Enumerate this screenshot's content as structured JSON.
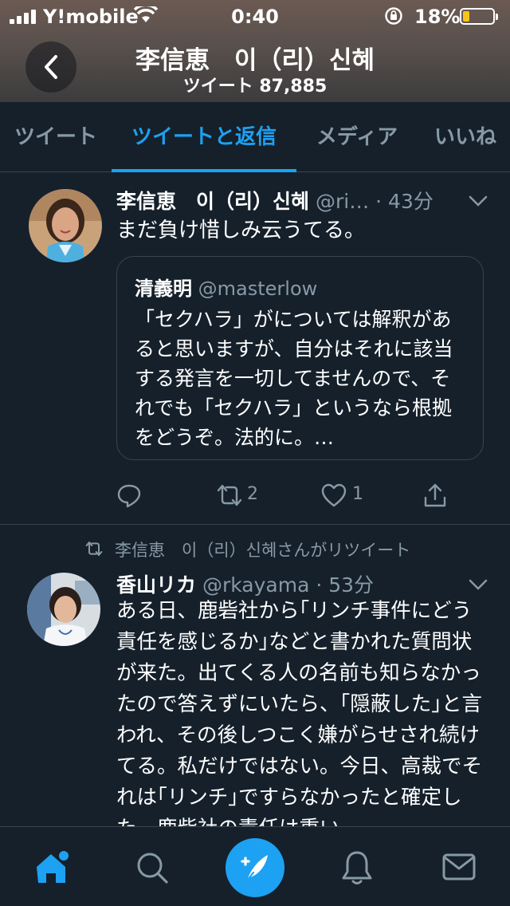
{
  "status_bar": {
    "carrier": "Y!mobile",
    "time": "0:40",
    "battery": "18%",
    "battery_level": 0.18
  },
  "header": {
    "name": "李信恵　이（리）신혜",
    "tweet_count": "ツイート 87,885"
  },
  "tabs": [
    {
      "label": "ツイート",
      "active": false
    },
    {
      "label": "ツイートと返信",
      "active": true
    },
    {
      "label": "メディア",
      "active": false
    },
    {
      "label": "いいね",
      "active": false
    }
  ],
  "tweets": [
    {
      "name": "李信恵　이（리）신혜",
      "handle": "@ri…",
      "time": "· 43分",
      "text": "まだ負け惜しみ云うてる。",
      "quote": {
        "name": "清義明",
        "handle": "@masterlow",
        "text": "「セクハラ」がについては解釈があると思いますが、自分はそれに該当する発言を一切してませんので、それでも「セクハラ」というなら根拠をどうぞ。法的に。…"
      },
      "retweets": "2",
      "likes": "1"
    },
    {
      "retweeted_by": "李信恵　이（리）신혜さんがリツイート",
      "name": "香山リカ",
      "handle": "@rkayama",
      "time": "· 53分",
      "text": "ある日、鹿砦社から｢リンチ事件にどう責任を感じるか｣などと書かれた質問状が来た。出てくる人の名前も知らなかったので答えずにいたら、｢隠蔽した｣と言われ、その後しつこく嫌がらせされ続けてる。私だけではない。今日、高裁でそれは｢リンチ｣ですらなかったと確定した。鹿砦社の責任は重い。"
    }
  ],
  "bottom_nav": [
    "home-icon",
    "search-icon",
    "compose-icon",
    "notifications-icon",
    "messages-icon"
  ],
  "colors": {
    "background": "#15202b",
    "accent": "#1da1f2",
    "secondary_text": "#8899a6",
    "border": "#38444d"
  }
}
